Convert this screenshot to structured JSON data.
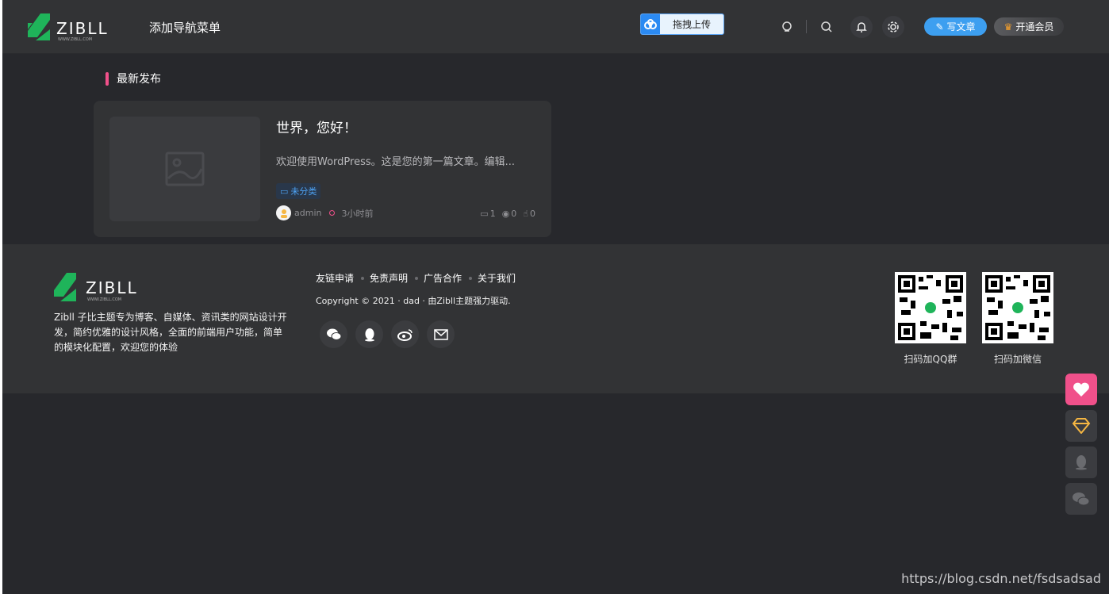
{
  "header": {
    "logo_text": "ZIBLL",
    "logo_sub": "WWW.ZIBLL.COM",
    "nav_add_label": "添加导航菜单",
    "upload_label": "拖拽上传",
    "write_label": "写文章",
    "vip_label": "开通会员"
  },
  "section": {
    "title": "最新发布"
  },
  "post": {
    "title": "世界，您好！",
    "excerpt": "欢迎使用WordPress。这是您的第一篇文章。编辑...",
    "tag": "未分类",
    "author": "admin",
    "time": "3小时前",
    "comments": "1",
    "views": "0",
    "likes": "0"
  },
  "footer": {
    "logo_text": "ZIBLL",
    "logo_sub": "WWW.ZIBLL.COM",
    "description": "Zibll 子比主题专为博客、自媒体、资讯类的网站设计开发，简约优雅的设计风格，全面的前端用户功能，简单的模块化配置，欢迎您的体验",
    "links": [
      "友链申请",
      "免责声明",
      "广告合作",
      "关于我们"
    ],
    "copyright": "Copyright © 2021 · dad · 由Zibll主题强力驱动.",
    "qr": [
      {
        "label": "扫码加QQ群"
      },
      {
        "label": "扫码加微信"
      }
    ]
  },
  "watermark": "https://blog.csdn.net/fsdsadsad",
  "colors": {
    "accent_pink": "#f0508a",
    "accent_blue": "#3d9ff0",
    "logo_green": "#1fb45a"
  }
}
